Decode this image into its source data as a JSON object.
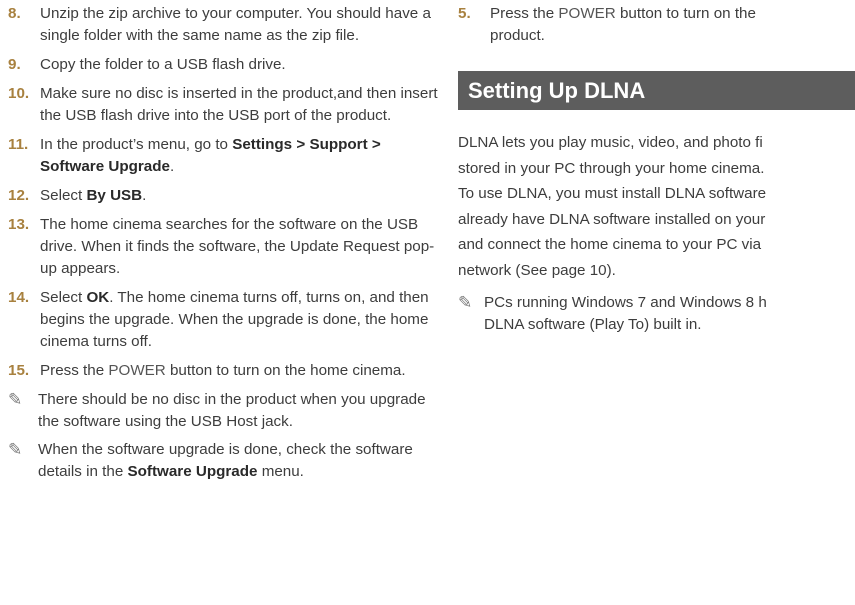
{
  "left": {
    "steps": [
      {
        "num": "8.",
        "text": "Unzip the zip archive to your computer. You should have a single folder with the same name as the zip file."
      },
      {
        "num": "9.",
        "text": "Copy the folder to a USB flash drive."
      },
      {
        "num": "10.",
        "text": "Make sure no disc is inserted in the product,and then insert the USB flash drive into the USB port of the product."
      },
      {
        "num": "11.",
        "pre": "In the product’s menu, go to ",
        "bold": "Settings > Support > Software Upgrade",
        "post": "."
      },
      {
        "num": "12.",
        "pre": "Select ",
        "bold": "By USB",
        "post": "."
      },
      {
        "num": "13.",
        "text": "The home cinema searches for the software on the USB drive. When it finds the software, the Update Request pop-up appears."
      },
      {
        "num": "14.",
        "pre": "Select ",
        "bold": "OK",
        "post": ". The home cinema turns off, turns on, and then begins the upgrade. When the upgrade is done, the home cinema turns off."
      },
      {
        "num": "15.",
        "pre": "Press the ",
        "bold": "POWER",
        "post": " button to turn on the home cinema."
      }
    ],
    "notes": [
      {
        "text": "There should be no disc in the product when you upgrade the software using the USB Host jack."
      },
      {
        "pre": "When the software upgrade is done, check the software details in the ",
        "bold": "Software Upgrade",
        "post": " menu."
      }
    ]
  },
  "right": {
    "step5": {
      "num": "5.",
      "pre": "Press the ",
      "bold": "POWER",
      "post": " button to turn on the",
      "line2": "product."
    },
    "heading": "Setting Up DLNA",
    "para_lines": [
      "DLNA lets you play music, video, and photo fi",
      "stored in your PC through your home cinema.",
      "To use DLNA, you must install DLNA software",
      "already have DLNA software installed on your",
      "and connect the home cinema to your PC via",
      "network (See page 10)."
    ],
    "note_lines": [
      "PCs running Windows 7 and Windows 8 h",
      "DLNA software (Play To) built in."
    ]
  },
  "icons": {
    "note": "pencil-note-icon",
    "note_glyph": "✎"
  },
  "colors": {
    "step_number": "#a8813f",
    "banner_bg": "#5d5d5d",
    "banner_text": "#ffffff"
  }
}
